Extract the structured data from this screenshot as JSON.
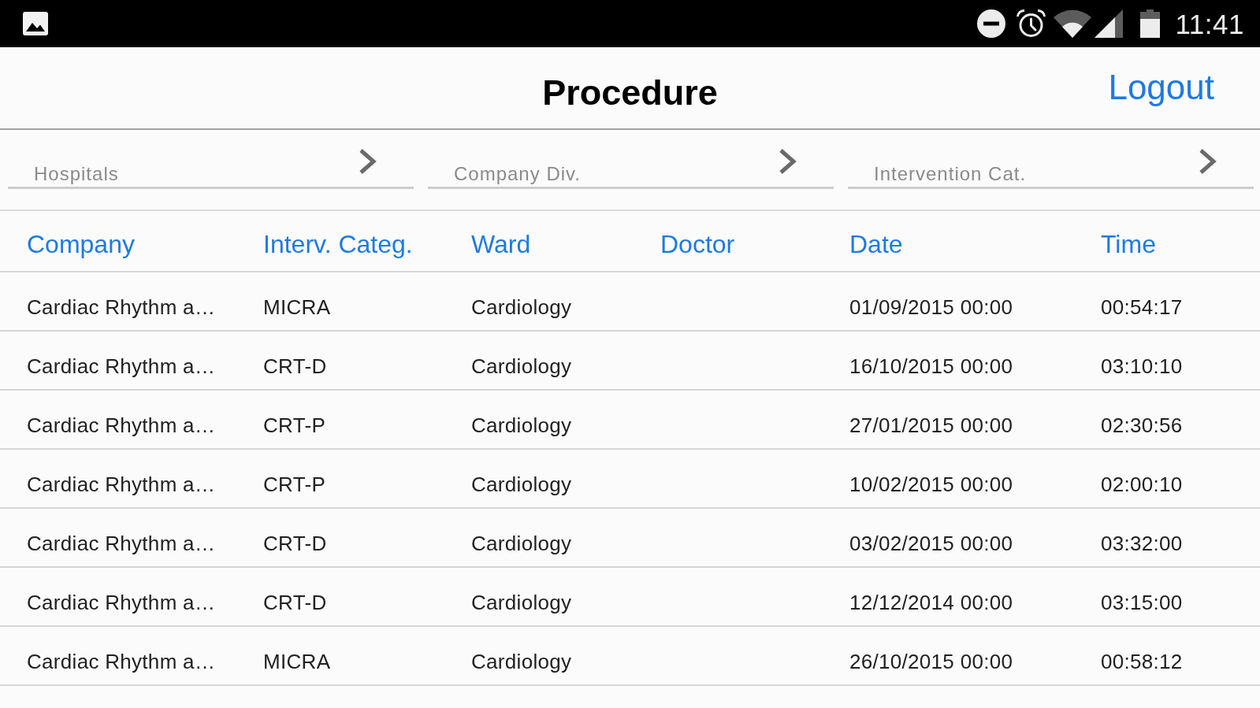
{
  "status_bar": {
    "time": "11:41"
  },
  "header": {
    "title": "Procedure",
    "logout": "Logout"
  },
  "filters": [
    {
      "placeholder": "Hospitals"
    },
    {
      "placeholder": "Company Div."
    },
    {
      "placeholder": "Intervention Cat."
    }
  ],
  "table": {
    "columns": [
      "Company",
      "Interv. Categ.",
      "Ward",
      "Doctor",
      "Date",
      "Time"
    ],
    "rows": [
      {
        "company": "Cardiac Rhythm a…",
        "category": "MICRA",
        "ward": "Cardiology",
        "date": "01/09/2015 00:00",
        "time": "00:54:17"
      },
      {
        "company": "Cardiac Rhythm a…",
        "category": "CRT-D",
        "ward": "Cardiology",
        "date": "16/10/2015 00:00",
        "time": "03:10:10"
      },
      {
        "company": "Cardiac Rhythm a…",
        "category": "CRT-P",
        "ward": "Cardiology",
        "date": "27/01/2015 00:00",
        "time": "02:30:56"
      },
      {
        "company": "Cardiac Rhythm a…",
        "category": "CRT-P",
        "ward": "Cardiology",
        "date": "10/02/2015 00:00",
        "time": "02:00:10"
      },
      {
        "company": "Cardiac Rhythm a…",
        "category": "CRT-D",
        "ward": "Cardiology",
        "date": "03/02/2015 00:00",
        "time": "03:32:00"
      },
      {
        "company": "Cardiac Rhythm a…",
        "category": "CRT-D",
        "ward": "Cardiology",
        "date": "12/12/2014 00:00",
        "time": "03:15:00"
      },
      {
        "company": "Cardiac Rhythm a…",
        "category": "MICRA",
        "ward": "Cardiology",
        "date": "26/10/2015 00:00",
        "time": "00:58:12"
      }
    ]
  }
}
